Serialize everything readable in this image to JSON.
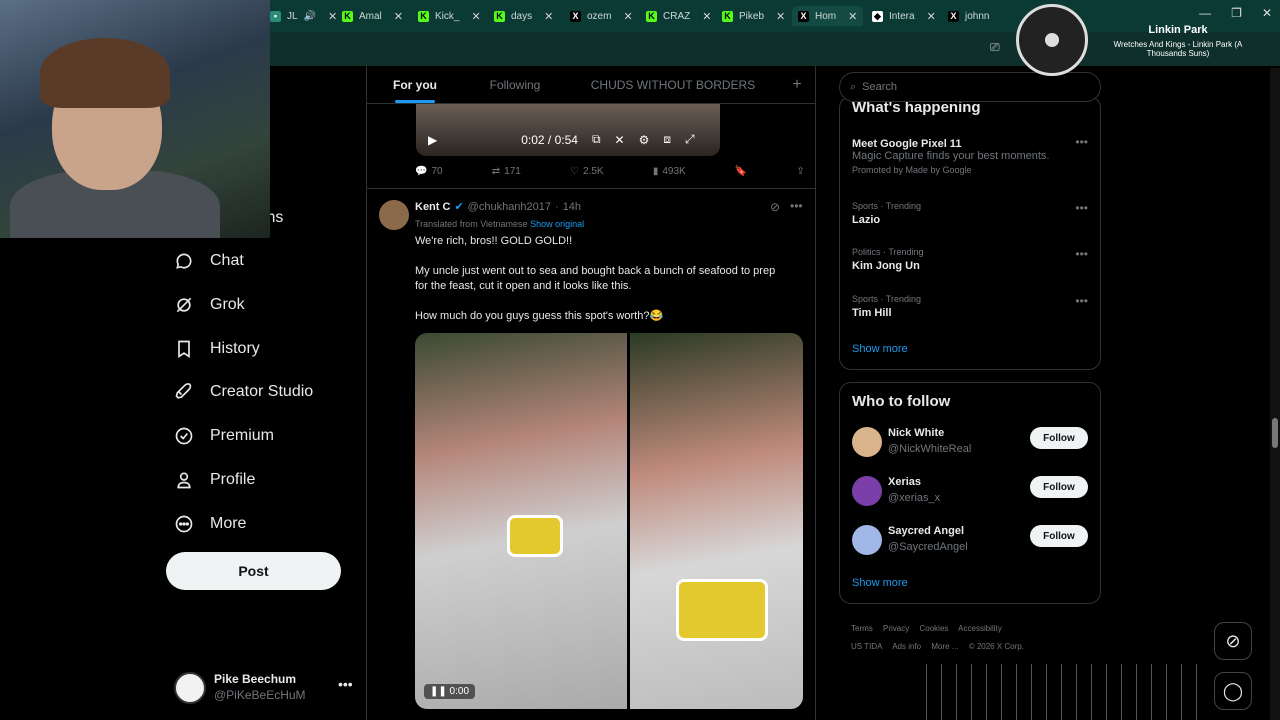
{
  "browser": {
    "tabs": [
      {
        "icon": "speaker-icon",
        "label": "JL"
      },
      {
        "icon": "kick-icon",
        "label": "Amal"
      },
      {
        "icon": "kick-icon",
        "label": "Kick_"
      },
      {
        "icon": "kick-icon",
        "label": "days"
      },
      {
        "icon": "x-icon",
        "label": "ozem"
      },
      {
        "icon": "kick-icon",
        "label": "CRAZ"
      },
      {
        "icon": "kick-icon",
        "label": "Pikeb"
      },
      {
        "icon": "x-icon",
        "label": "Hom"
      },
      {
        "icon": "diamond-icon",
        "label": "Intera"
      },
      {
        "icon": "x-icon",
        "label": "johnn"
      }
    ],
    "active_tab": 7,
    "ask_gemini": "Ask Gemini"
  },
  "now_playing": {
    "artist": "Linkin Park",
    "song": "Wretches And Kings - Linkin Park (A Thousands Suns)"
  },
  "left_nav": {
    "partial_label": "ions",
    "items": [
      {
        "label": "Chat",
        "icon": "chat-bubble-icon"
      },
      {
        "label": "Grok",
        "icon": "grok-icon"
      },
      {
        "label": "History",
        "icon": "bookmark-icon"
      },
      {
        "label": "Creator Studio",
        "icon": "rocket-icon"
      },
      {
        "label": "Premium",
        "icon": "verified-badge-icon"
      },
      {
        "label": "Profile",
        "icon": "person-icon"
      },
      {
        "label": "More",
        "icon": "more-circle-icon"
      }
    ],
    "post_button": "Post",
    "account": {
      "name": "Pike Beechum",
      "handle": "@PiKeBeEcHuM"
    }
  },
  "feed": {
    "tabs": [
      "For you",
      "Following",
      "CHUDS WITHOUT BORDERS"
    ],
    "active_tab": 0,
    "add_tab": "+",
    "prev_video": {
      "time": "0:02 / 0:54"
    },
    "prev_actions": {
      "replies": "70",
      "reposts": "171",
      "likes": "2.5K",
      "views": "493K"
    },
    "tweet": {
      "name": "Kent C",
      "handle": "@chukhanh2017",
      "time": "14h",
      "translated": "Translated from Vietnamese",
      "show_original": "Show original",
      "lines": [
        "We're rich, bros!! GOLD GOLD!!",
        "My uncle just went out to sea and bought back a bunch of seafood to prep",
        "for the feast, cut it open and it looks like this.",
        "How much do you guys guess this spot's worth?😂"
      ],
      "video_time": "0:00"
    }
  },
  "right": {
    "search_placeholder": "Search",
    "trends_title": "What's happening",
    "trends": [
      {
        "meta": "",
        "title": "Meet Google Pixel 11",
        "sub": "Magic Capture finds your best moments.",
        "promo": "Promoted by Made by Google"
      },
      {
        "meta": "Sports · Trending",
        "title": "Lazio"
      },
      {
        "meta": "Politics · Trending",
        "title": "Kim Jong Un"
      },
      {
        "meta": "Sports · Trending",
        "title": "Tim Hill"
      }
    ],
    "trends_show_more": "Show more",
    "who_title": "Who to follow",
    "who": [
      {
        "name": "Nick White",
        "handle": "@NickWhiteReal",
        "follow": "Follow"
      },
      {
        "name": "Xerias",
        "handle": "@xerias_x",
        "follow": "Follow"
      },
      {
        "name": "Saycred Angel",
        "handle": "@SaycredAngel",
        "follow": "Follow"
      }
    ],
    "who_show_more": "Show more",
    "footer": [
      "Terms",
      "Privacy",
      "Cookies",
      "Accessibility",
      "US TIDA",
      "Ads info",
      "More ...",
      "© 2026 X Corp."
    ]
  },
  "colors": {
    "accent": "#1d9bf0",
    "border": "#2f3336",
    "muted": "#71767b",
    "browser": "#0b3a34"
  }
}
